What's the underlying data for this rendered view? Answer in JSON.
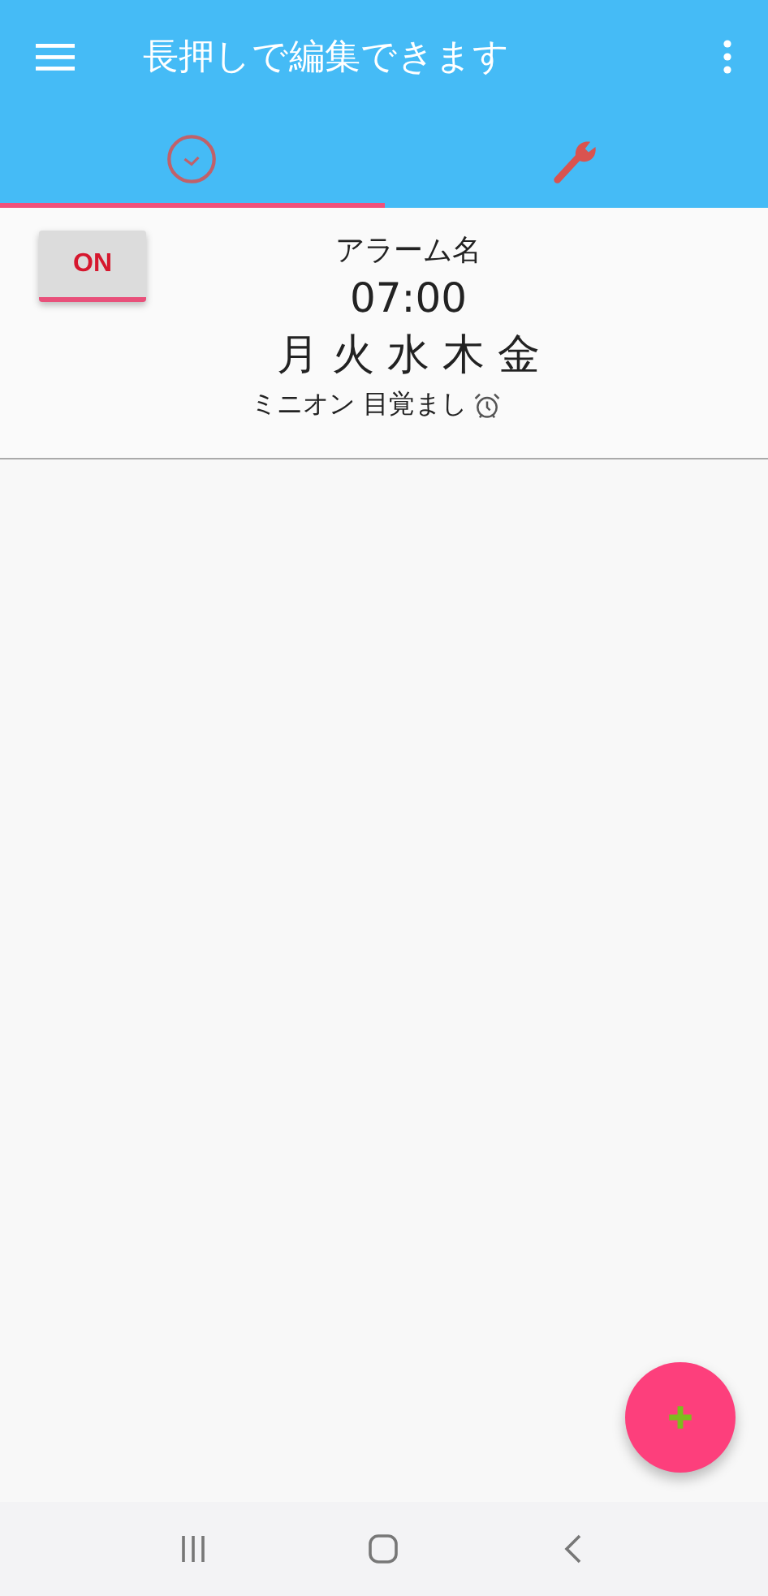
{
  "app_bar": {
    "title": "長押しで編集できます"
  },
  "tabs": [
    {
      "kind": "clock",
      "selected": true
    },
    {
      "kind": "wrench",
      "selected": false
    }
  ],
  "alarms": [
    {
      "toggle": {
        "label": "ON",
        "on": true
      },
      "name": "アラーム名",
      "time": "07:00",
      "days": [
        "月",
        "火",
        "水",
        "木",
        "金"
      ],
      "sound": "ミニオン 目覚まし"
    }
  ]
}
